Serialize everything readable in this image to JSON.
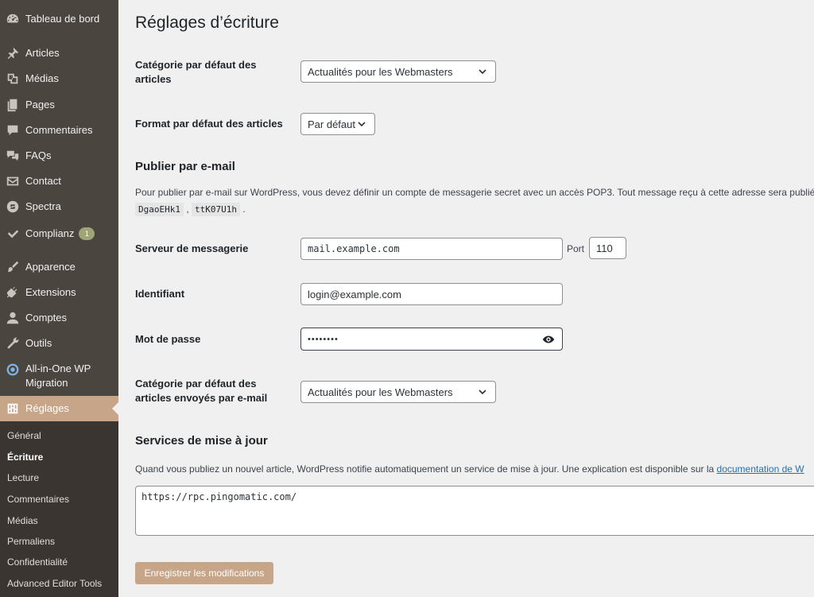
{
  "sidebar": {
    "items": [
      {
        "label": "Tableau de bord",
        "icon": "dashboard-icon"
      },
      {
        "label": "Articles",
        "icon": "pin-icon"
      },
      {
        "label": "Médias",
        "icon": "media-icon"
      },
      {
        "label": "Pages",
        "icon": "pages-icon"
      },
      {
        "label": "Commentaires",
        "icon": "comment-icon"
      },
      {
        "label": "FAQs",
        "icon": "faq-icon"
      },
      {
        "label": "Contact",
        "icon": "mail-icon"
      },
      {
        "label": "Spectra",
        "icon": "spectra-icon"
      },
      {
        "label": "Complianz",
        "icon": "check-icon",
        "badge": "1"
      },
      {
        "label": "Apparence",
        "icon": "brush-icon"
      },
      {
        "label": "Extensions",
        "icon": "plugin-icon"
      },
      {
        "label": "Comptes",
        "icon": "user-icon"
      },
      {
        "label": "Outils",
        "icon": "wrench-icon"
      },
      {
        "label": "All-in-One WP",
        "label2": "Migration",
        "icon": "migration-icon"
      },
      {
        "label": "Réglages",
        "icon": "settings-icon"
      }
    ],
    "submenu": [
      "Général",
      "Écriture",
      "Lecture",
      "Commentaires",
      "Médias",
      "Permaliens",
      "Confidentialité",
      "Advanced Editor Tools"
    ]
  },
  "main": {
    "title": "Réglages d’écriture",
    "default_category": {
      "label_line1": "Catégorie par défaut des",
      "label_line2": "articles",
      "value": "Actualités pour les Webmasters"
    },
    "default_format": {
      "label": "Format par défaut des articles",
      "value": "Par défaut"
    },
    "email": {
      "title": "Publier par e-mail",
      "description": "Pour publier par e-mail sur WordPress, vous devez définir un compte de messagerie secret avec un accès POP3. Tout message reçu à cette adresse sera publié.",
      "code1": "DgaoEHk1",
      "sep": ",",
      "code2": "ttK07U1h",
      "end": ".",
      "server_label": "Serveur de messagerie",
      "server_value": "mail.example.com",
      "port_label": "Port",
      "port_value": "110",
      "login_label": "Identifiant",
      "login_value": "login@example.com",
      "password_label": "Mot de passe",
      "password_value": "••••••••",
      "cat_label_line1": "Catégorie par défaut des",
      "cat_label_line2": "articles envoyés par e-mail",
      "cat_value": "Actualités pour les Webmasters"
    },
    "update": {
      "title": "Services de mise à jour",
      "description": "Quand vous publiez un nouvel article, WordPress notifie automatiquement un service de mise à jour. Une explication est disponible sur la",
      "link": "documentation de W",
      "services": "https://rpc.pingomatic.com/"
    },
    "save_label": "Enregistrer les modifications"
  },
  "colors": {
    "sidebar_bg": "#4b4540",
    "submenu_bg": "#3a3531",
    "accent": "#c7a589",
    "link": "#2271b1"
  }
}
